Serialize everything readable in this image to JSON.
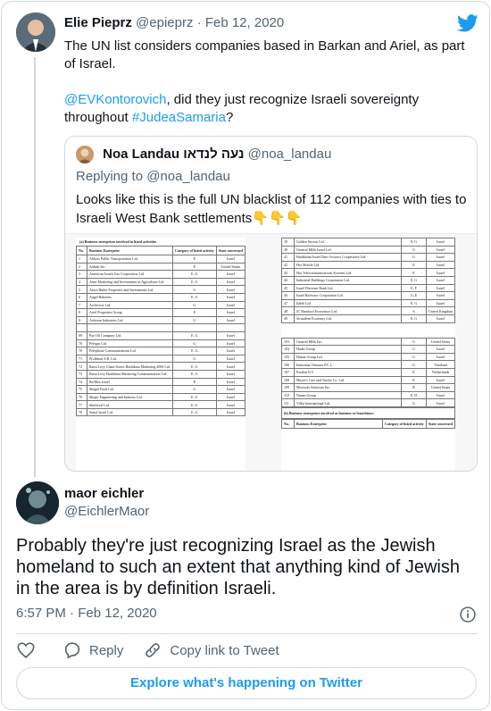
{
  "parent_tweet": {
    "display_name": "Elie Pieprz",
    "handle": "@epieprz",
    "separator": "·",
    "date": "Feb 12, 2020",
    "text_line1": "The UN list considers companies based in Barkan and Ariel, as part of Israel.",
    "mention": "@EVKontorovich",
    "text_mid": ", did they just recognize Israeli sovereignty throughout ",
    "hashtag": "#JudeaSamaria",
    "text_end": "?"
  },
  "quoted_tweet": {
    "display_name": "Noa Landau נעה לנדאו",
    "handle": "@noa_landau",
    "replying_label": "Replying to",
    "replying_handle": "@noa_landau",
    "text": "Looks like this is the full UN blacklist of 112 companies with ties to Israeli West Bank settlements👇👇👇",
    "image": {
      "left_heading": "(a) Business enterprises involved in listed activities",
      "left_columns": [
        "No.",
        "Business Enterprise",
        "Category of listed activity",
        "State concerned"
      ],
      "left_rows": [
        [
          "1",
          "Afikim Public Transportation Ltd.",
          "E",
          "Israel"
        ],
        [
          "2",
          "Airbnb Inc.",
          "E",
          "United States"
        ],
        [
          "3",
          "American Israeli Gas Corporation Ltd.",
          "E, G",
          "Israel"
        ],
        [
          "4",
          "Amir Marketing and Investments in Agriculture Ltd.",
          "E, G",
          "Israel"
        ],
        [
          "5",
          "Amos Hadar Properties and Investments Ltd.",
          "G",
          "Israel"
        ],
        [
          "6",
          "Angel Bakeries",
          "E, G",
          "Israel"
        ],
        [
          "7",
          "Archivists Ltd.",
          "G",
          "Israel"
        ],
        [
          "8",
          "Ariel Properties Group",
          "E",
          "Israel"
        ],
        [
          "9",
          "Ashtrom Industries Ltd.",
          "G",
          "Israel"
        ],
        [
          "",
          "",
          "",
          ""
        ],
        [
          "69",
          "Paz Oil Company Ltd.",
          "E, G",
          "Israel"
        ],
        [
          "70",
          "Pelegas Ltd.",
          "G",
          "Israel"
        ],
        [
          "70",
          "Pelephone Communications Ltd.",
          "E, G",
          "Israel"
        ],
        [
          "71",
          "Proffimat S.R. Ltd.",
          "G",
          "Israel"
        ],
        [
          "72",
          "Rami Levy Chain Stores Hashikma Marketing 2006 Ltd.",
          "E, G",
          "Israel"
        ],
        [
          "73",
          "Rami Levy Hashikma Marketing Communication Ltd.",
          "E, G",
          "Israel"
        ],
        [
          "74",
          "Re/Max Israel",
          "E",
          "Israel"
        ],
        [
          "75",
          "Shagal Food Ltd.",
          "G",
          "Israel"
        ],
        [
          "76",
          "Shapir Engineering and Industry Ltd.",
          "E, G",
          "Israel"
        ],
        [
          "77",
          "Shufersal Ltd.",
          "E, G",
          "Israel"
        ],
        [
          "78",
          "Sonol Israel Ltd.",
          "E, G",
          "Israel"
        ]
      ],
      "right_rows_top": [
        [
          "39",
          "Golden Stroots Ltd.",
          "E, G",
          "Israel"
        ],
        [
          "40",
          "General Mills Israel Ltd.",
          "G",
          "Israel"
        ],
        [
          "41",
          "Hadiklaim Israel Date Growers Cooperative Ltd.",
          "G",
          "Israel"
        ],
        [
          "42",
          "Hot Mobile Ltd.",
          "E",
          "Israel"
        ],
        [
          "43",
          "Hot Telecommunications Systems Ltd.",
          "E",
          "Israel"
        ],
        [
          "44",
          "Industrial Buildings Corporation Ltd.",
          "E, G",
          "Israel"
        ],
        [
          "45",
          "Israel Discount Bank Ltd.",
          "E, F",
          "Israel"
        ],
        [
          "46",
          "Israel Railways Corporation Ltd.",
          "G, E",
          "Israel"
        ],
        [
          "47",
          "Italek Ltd.",
          "E, G",
          "Israel"
        ],
        [
          "48",
          "JC Bamford Excavators Ltd.",
          "A",
          "United Kingdom"
        ],
        [
          "49",
          "Jerusalem Economy Ltd.",
          "E, G",
          "Israel"
        ]
      ],
      "right_rows_bottom": [
        [
          "103",
          "General Mills Inc.",
          "G",
          "United States"
        ],
        [
          "104",
          "Hadar Group",
          "G",
          "Israel"
        ],
        [
          "105",
          "Hamat Group Ltd.",
          "G",
          "Israel"
        ],
        [
          "106",
          "Indorama Ventures P.C.L.",
          "G",
          "Thailand"
        ],
        [
          "107",
          "Kardan N.V.",
          "E",
          "Netherlands"
        ],
        [
          "108",
          "Mayer's Cars and Trucks Co. Ltd.",
          "E",
          "Israel"
        ],
        [
          "109",
          "Motorola Solutions Inc.",
          "B",
          "United States"
        ],
        [
          "110",
          "Natam Group",
          "E, D",
          "Israel"
        ],
        [
          "111",
          "Villar International Ltd.",
          "G",
          "Israel"
        ]
      ],
      "right_heading": "(b) Business enterprises involved as business or franchisors",
      "right_columns": [
        "No.",
        "Business Enterprise",
        "Category of listed activity",
        "State concerned"
      ]
    }
  },
  "reply_tweet": {
    "display_name": "maor eichler",
    "handle": "@EichlerMaor",
    "text": "Probably they're just recognizing Israel as the Jewish homeland to such an extent that anything kind of Jewish in the area is by definition Israeli.",
    "time": "6:57 PM",
    "separator": "·",
    "date": "Feb 12, 2020"
  },
  "actions": {
    "reply_label": "Reply",
    "copy_label": "Copy link to Tweet"
  },
  "explore_label": "Explore what's happening on Twitter",
  "colors": {
    "accent": "#1d9bf0",
    "text": "#0f1419",
    "muted": "#536471",
    "border": "#cfd9de"
  },
  "icons": [
    "twitter-bird-icon",
    "info-icon",
    "heart-icon",
    "reply-icon",
    "link-icon"
  ]
}
